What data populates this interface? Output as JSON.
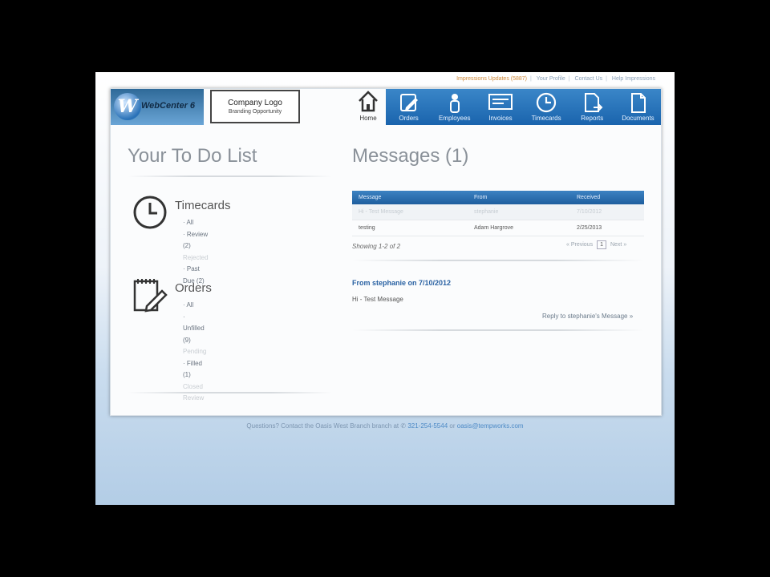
{
  "top_links": {
    "staffing_link": "Impressions Updates (5887)",
    "profile": "Your Profile",
    "contact": "Contact Us",
    "help": "Help Impressions"
  },
  "brand": {
    "logo_letter": "W",
    "logo_text": "WebCenter 6",
    "company_logo_title": "Company Logo",
    "company_logo_subtitle": "Branding Opportunity"
  },
  "nav": {
    "home_label": "Home",
    "items": [
      {
        "label": "Orders",
        "icon": "pencil-icon"
      },
      {
        "label": "Employees",
        "icon": "person-icon"
      },
      {
        "label": "Invoices",
        "icon": "invoice-icon"
      },
      {
        "label": "Timecards",
        "icon": "clock-icon"
      },
      {
        "label": "Reports",
        "icon": "report-icon"
      },
      {
        "label": "Documents",
        "icon": "document-icon"
      }
    ]
  },
  "todo": {
    "title": "Your To Do List",
    "timecards": {
      "title": "Timecards",
      "items": [
        "· All",
        "· Review (2)",
        "Rejected",
        "· Past Due (2)"
      ]
    },
    "orders": {
      "title": "Orders",
      "items": [
        "· All",
        "· Unfilled (9)",
        "Pending",
        "· Filled (1)",
        "Closed",
        "Review"
      ]
    }
  },
  "messages": {
    "title": "Messages (1)",
    "columns": [
      "Message",
      "From",
      "Received"
    ],
    "rows": [
      {
        "message": "Hi - Test Message",
        "from": "stephanie",
        "received": "7/10/2012"
      },
      {
        "message": "testing",
        "from": "Adam Hargrove",
        "received": "2/25/2013"
      }
    ],
    "showing": "Showing 1-2 of 2",
    "prev": "« Previous",
    "page": "1",
    "next": "Next »",
    "detail_from": "From stephanie on 7/10/2012",
    "detail_body": "Hi - Test Message",
    "reply": "Reply to stephanie's Message »"
  },
  "footer": {
    "text": "Questions? Contact the Oasis West Branch branch at",
    "phone": "321-254-5544",
    "or": "or",
    "email": "oasis@tempworks.com"
  },
  "colors": {
    "nav_blue": "#1a64ad",
    "link_blue": "#2a62a3"
  }
}
